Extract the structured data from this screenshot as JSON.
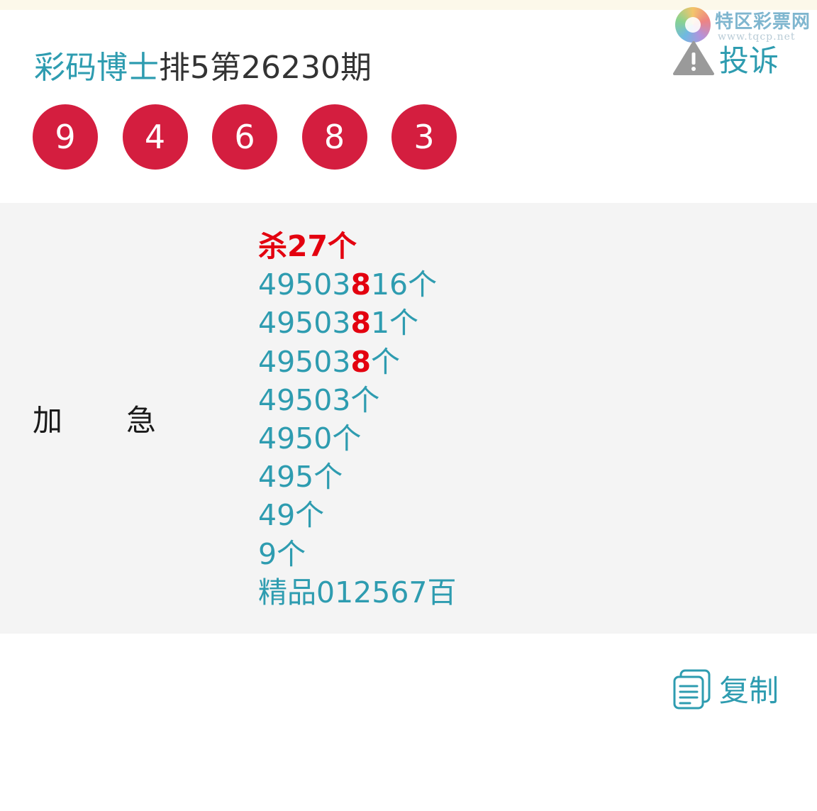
{
  "watermark": {
    "name": "特区彩票网",
    "url": "www.tqcp.net"
  },
  "header": {
    "author": "彩码博士",
    "title_rest": "排5第26230期",
    "complaint_label": "投诉"
  },
  "balls": [
    "9",
    "4",
    "6",
    "8",
    "3"
  ],
  "content": {
    "label_1": "加",
    "label_2": "急",
    "kill_line": "杀27个",
    "lines": [
      {
        "pre": "49503",
        "hl": "8",
        "post": "16个"
      },
      {
        "pre": "49503",
        "hl": "8",
        "post": "1个"
      },
      {
        "pre": "49503",
        "hl": "8",
        "post": "个"
      },
      {
        "pre": "49503个",
        "hl": "",
        "post": ""
      },
      {
        "pre": "4950个",
        "hl": "",
        "post": ""
      },
      {
        "pre": "495个",
        "hl": "",
        "post": ""
      },
      {
        "pre": "49个",
        "hl": "",
        "post": ""
      },
      {
        "pre": "9个",
        "hl": "",
        "post": ""
      },
      {
        "pre": "精品012567百",
        "hl": "",
        "post": ""
      }
    ]
  },
  "footer": {
    "copy_label": "复制"
  },
  "colors": {
    "accent": "#2e9cb0",
    "ball": "#d41e3f",
    "highlight": "#e3000f",
    "panel": "#f4f4f4"
  }
}
